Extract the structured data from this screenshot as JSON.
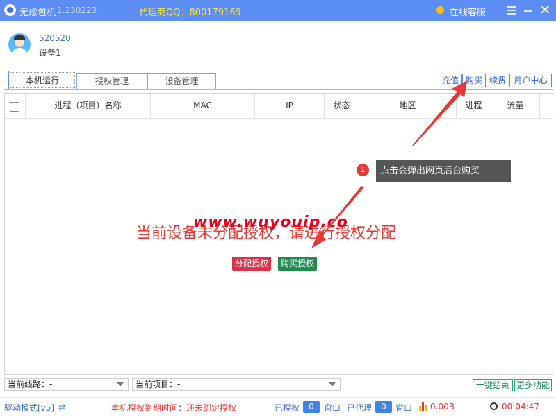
{
  "titlebar": {
    "app_name": "无虑包机",
    "version": "1.230223",
    "agent_qq": "代理商QQ：800179169",
    "support": "在线客服"
  },
  "user": {
    "name": "520520",
    "device": "设备1"
  },
  "tabs": [
    {
      "label": "本机运行",
      "active": true
    },
    {
      "label": "授权管理",
      "active": false
    },
    {
      "label": "设备管理",
      "active": false
    }
  ],
  "right_buttons": [
    "充值",
    "购买",
    "续费",
    "用户中心"
  ],
  "table": {
    "columns": [
      "进程（项目）名称",
      "MAC",
      "IP",
      "状态",
      "地区",
      "进程",
      "流量"
    ]
  },
  "notice": "当前设备未分配授权，请进行授权分配",
  "watermark": "www.wuyouip.co",
  "actions": {
    "assign": "分配授权",
    "buy": "购买授权"
  },
  "tooltip": {
    "number": "1",
    "text": "点击会弹出网页后台购买"
  },
  "bottom": {
    "line_label": "当前线路：-",
    "project_label": "当前项目：-",
    "end_all": "一键结束",
    "more": "更多功能"
  },
  "statusbar": {
    "mode": "驱动模式[v5]",
    "expire": "本机授权到期时间：还未绑定授权",
    "authorized_label": "已授权",
    "authorized_count": "0",
    "window1": "窗口",
    "proxied_label": "已代理",
    "proxied_count": "0",
    "window2": "窗口",
    "traffic": "0.00B",
    "timer": "00:04:47"
  },
  "colors": {
    "titlebar": "#5b8df5",
    "accent_red": "#e53935",
    "accent_green": "#1f8c4e",
    "badge_blue": "#3f82e8"
  }
}
